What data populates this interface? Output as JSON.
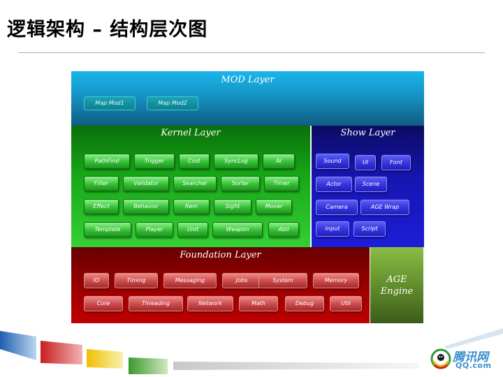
{
  "title": "逻辑架构 – 结构层次图",
  "colors": {
    "mod_layer": "#1593c4",
    "kernel_layer": "#17a617",
    "show_layer": "#1616b4",
    "foundation_layer": "#930000",
    "age_layer": "#5e8a2a",
    "logo": "#3a8fcf"
  },
  "layers": {
    "mod": {
      "title": "MOD Layer",
      "items": [
        "Map Mod1",
        "Map Mod2"
      ]
    },
    "kernel": {
      "title": "Kernel Layer",
      "rows": [
        [
          "PathFind",
          "Trigger",
          "Cost",
          "SyncLog",
          "AI"
        ],
        [
          "Filter",
          "Validator",
          "Searcher",
          "Sorter",
          "Timer"
        ],
        [
          "Effect",
          "Behavior",
          "Item",
          "Sight",
          "Mover"
        ],
        [
          "Template",
          "Player",
          "Unit",
          "Weapon",
          "Abil"
        ]
      ]
    },
    "show": {
      "title": "Show Layer",
      "rows": [
        [
          "Sound",
          "UI",
          "Font"
        ],
        [
          "Actor",
          "Scene"
        ],
        [
          "Camera",
          "AGE Wrap"
        ],
        [
          "Input",
          "Script"
        ]
      ]
    },
    "foundation": {
      "title": "Foundation Layer",
      "rows": [
        [
          "IO",
          "Timing",
          "Messaging",
          "Jobs",
          "System",
          "Memory"
        ],
        [
          "Core",
          "Threading",
          "Network",
          "Math",
          "Debug",
          "Util"
        ]
      ]
    },
    "age": {
      "line1": "AGE",
      "line2": "Engine"
    }
  },
  "logo": {
    "name": "腾讯网",
    "domain": "QQ.com"
  }
}
